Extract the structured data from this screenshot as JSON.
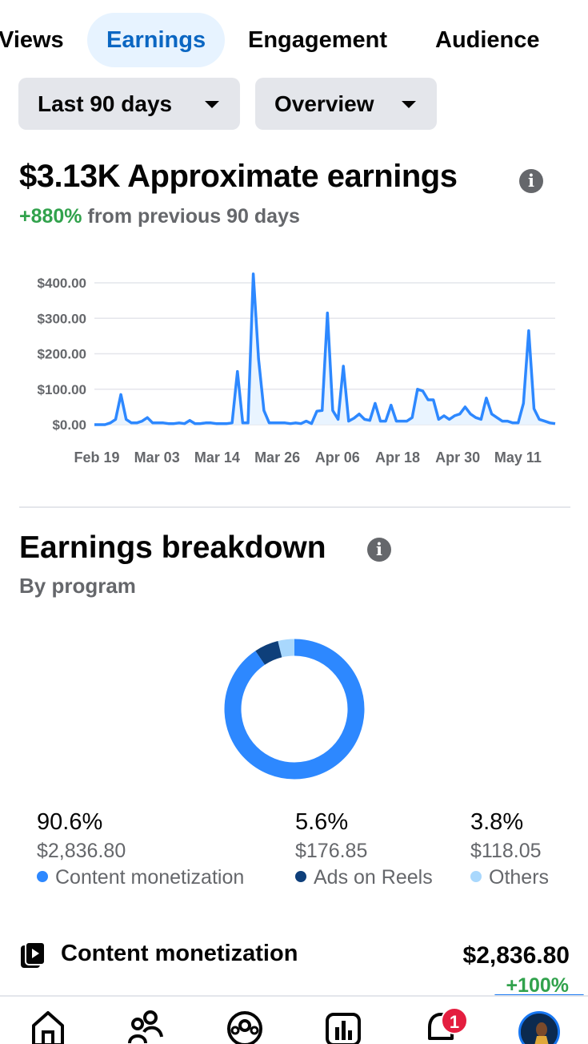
{
  "tabs": [
    {
      "label": "Views"
    },
    {
      "label": "Earnings",
      "active": true
    },
    {
      "label": "Engagement"
    },
    {
      "label": "Audience"
    }
  ],
  "filters": {
    "date_range": "Last 90 days",
    "view": "Overview"
  },
  "summary": {
    "amount": "$3.13K",
    "title": "Approximate earnings",
    "change": "+880%",
    "change_text": "from previous 90 days"
  },
  "chart_data": {
    "type": "area",
    "title": "",
    "xlabel": "",
    "ylabel": "",
    "ylim": [
      0,
      400
    ],
    "y_ticks": [
      "$400.00",
      "$300.00",
      "$200.00",
      "$100.00",
      "$0.00"
    ],
    "x_ticks": [
      "Feb 19",
      "Mar 03",
      "Mar 14",
      "Mar 26",
      "Apr 06",
      "Apr 18",
      "Apr 30",
      "May 11"
    ],
    "x_start": "2024-02-19",
    "grid": true,
    "series": [
      {
        "color": "#2d88ff",
        "values": [
          0,
          0,
          0,
          5,
          15,
          85,
          15,
          5,
          5,
          10,
          20,
          5,
          5,
          5,
          3,
          3,
          5,
          3,
          12,
          3,
          3,
          5,
          5,
          3,
          3,
          3,
          5,
          150,
          5,
          5,
          425,
          185,
          40,
          5,
          5,
          5,
          5,
          3,
          5,
          3,
          10,
          3,
          38,
          40,
          315,
          40,
          15,
          165,
          10,
          18,
          30,
          15,
          12,
          60,
          10,
          10,
          55,
          10,
          10,
          10,
          20,
          100,
          95,
          70,
          70,
          15,
          25,
          15,
          25,
          30,
          50,
          30,
          20,
          15,
          75,
          30,
          20,
          10,
          10,
          5,
          5,
          60,
          265,
          45,
          15,
          10,
          5,
          3
        ]
      }
    ]
  },
  "breakdown": {
    "title": "Earnings breakdown",
    "subtitle": "By program",
    "items": [
      {
        "percent": "90.6%",
        "share": 0.906,
        "amount": "$2,836.80",
        "label": "Content monetization",
        "color": "#2d88ff"
      },
      {
        "percent": "5.6%",
        "share": 0.056,
        "amount": "$176.85",
        "label": "Ads on Reels",
        "color": "#0e3f7a"
      },
      {
        "percent": "3.8%",
        "share": 0.038,
        "amount": "$118.05",
        "label": "Others",
        "color": "#a9d8fd"
      }
    ]
  },
  "program_row": {
    "label": "Content monetization",
    "amount": "$2,836.80",
    "change": "+100%"
  },
  "nav": {
    "items": [
      "home-icon",
      "friends-icon",
      "groups-icon",
      "dashboard-icon",
      "notifications-icon",
      "profile-avatar"
    ],
    "notification_count": "1"
  }
}
